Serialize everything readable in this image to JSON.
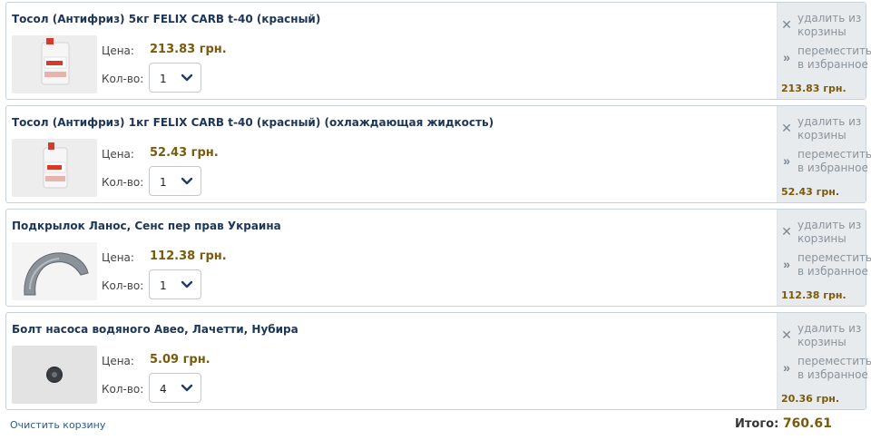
{
  "labels": {
    "price": "Цена:",
    "qty": "Кол-во:"
  },
  "actions": {
    "remove": "удалить из корзины",
    "move": "переместить в избранное"
  },
  "items": [
    {
      "title": "Тосол (Антифриз) 5кг FELIX CARB t-40 (красный)",
      "price": "213.83 грн.",
      "qty": "1",
      "total": "213.83 грн.",
      "thumb": "antifreeze-canister-5kg"
    },
    {
      "title": "Тосол (Антифриз) 1кг FELIX CARB t-40 (красный) (охлаждающая жидкость)",
      "price": "52.43 грн.",
      "qty": "1",
      "total": "52.43 грн.",
      "thumb": "antifreeze-canister-1kg"
    },
    {
      "title": "Подкрылок Ланос, Сенс пер прав Украина",
      "price": "112.38 грн.",
      "qty": "1",
      "total": "112.38 грн.",
      "thumb": "fender-liner"
    },
    {
      "title": "Болт насоса водяного Авео, Лачетти, Нубира",
      "price": "5.09 грн.",
      "qty": "4",
      "total": "20.36 грн.",
      "thumb": "pump-bolt"
    }
  ],
  "footer": {
    "clear_label": "Очистить корзину",
    "total_label": "Итого:",
    "total_value": "760.61"
  },
  "colors": {
    "price": "#7a5a0b",
    "title": "#1d3557",
    "side_bg": "#e8ebee",
    "link": "#2a5a8c"
  }
}
